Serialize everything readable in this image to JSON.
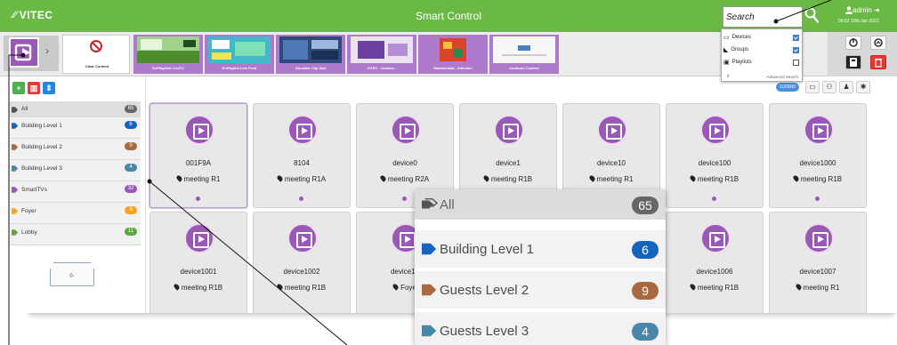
{
  "header": {
    "brand": "VITEC",
    "title": "Smart Control",
    "search": {
      "placeholder": "Search"
    },
    "user": {
      "name": "admin",
      "time": "09:52 10th Jan 2022"
    }
  },
  "search_dropdown": {
    "options": [
      {
        "label": "Devices",
        "checked": true
      },
      {
        "label": "Groups",
        "checked": true
      },
      {
        "label": "Playlists",
        "checked": false
      }
    ],
    "advanced": "Advanced Search"
  },
  "content_strip": {
    "clear_label": "Clear Content",
    "thumbnails": [
      {
        "label": "EnPlaylists LiveTV"
      },
      {
        "label": "EnPlaylist Live Feed"
      },
      {
        "label": "Glendale City Gov"
      },
      {
        "label": "VITEC - Custom -"
      },
      {
        "label": "Wankeredsk - Infection"
      },
      {
        "label": "Cautious Content"
      }
    ]
  },
  "sidebar": {
    "groups": [
      {
        "label": "All",
        "count": "65",
        "color": "#666666"
      },
      {
        "label": "Building Level 1",
        "count": "6",
        "color": "#1565c0"
      },
      {
        "label": "Building Level 2",
        "count": "9",
        "color": "#a9683f"
      },
      {
        "label": "Building Level 3",
        "count": "4",
        "color": "#4a86a8"
      },
      {
        "label": "SmartTVs",
        "count": "32",
        "color": "#9b59b6"
      },
      {
        "label": "Foyer",
        "count": "3",
        "color": "#f5a623"
      },
      {
        "label": "Lobby",
        "count": "11",
        "color": "#5aa83d"
      }
    ],
    "drop_zone_label": "0-"
  },
  "device_toolbar": {
    "counter": "1/20000"
  },
  "devices": [
    {
      "name": "001F9A",
      "location": "meeting R1"
    },
    {
      "name": "8104",
      "location": "meeting R1A"
    },
    {
      "name": "device0",
      "location": "meeting R2A"
    },
    {
      "name": "device1",
      "location": "meeting R1B"
    },
    {
      "name": "device10",
      "location": "meeting R1"
    },
    {
      "name": "device100",
      "location": "meeting R1B"
    },
    {
      "name": "device1000",
      "location": "meeting R1B"
    },
    {
      "name": "device1001",
      "location": "meeting R1B"
    },
    {
      "name": "device1002",
      "location": "meeting R1B"
    },
    {
      "name": "device10",
      "location": "Foye"
    },
    {
      "name": "",
      "location": ""
    },
    {
      "name": "",
      "location": ""
    },
    {
      "name": "device1006",
      "location": "meeting R1B"
    },
    {
      "name": "device1007",
      "location": "meeting R1"
    }
  ],
  "zoom_callout": {
    "rows": [
      {
        "label": "All",
        "count": "65",
        "color": "#666666"
      },
      {
        "label": "Building Level 1",
        "count": "6",
        "color": "#1565c0"
      },
      {
        "label": "Guests Level 2",
        "count": "9",
        "color": "#a9683f"
      },
      {
        "label": "Guests Level 3",
        "count": "4",
        "color": "#4a86a8"
      }
    ]
  },
  "colors": {
    "topbar": "#6ab944",
    "device_purple": "#9b59b6",
    "thumb_purple": "#b07acc"
  }
}
